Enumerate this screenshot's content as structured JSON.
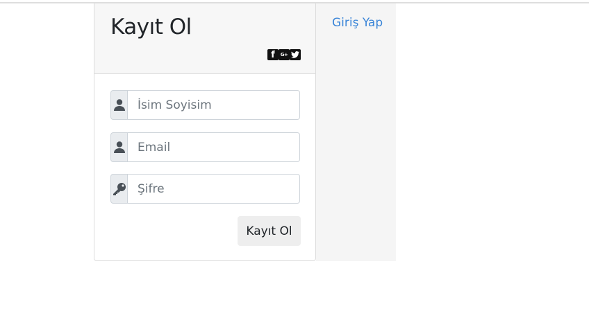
{
  "register_card": {
    "title": "Kayıt Ol",
    "social_icons": [
      "facebook-icon",
      "google-plus-icon",
      "twitter-icon"
    ],
    "name_field": {
      "placeholder": "İsim Soyisim",
      "icon": "user-icon"
    },
    "email_field": {
      "placeholder": "Email",
      "icon": "user-icon"
    },
    "password_field": {
      "placeholder": "Şifre",
      "icon": "key-icon"
    },
    "submit_label": "Kayıt Ol"
  },
  "side_panel": {
    "login_link": "Giriş Yap"
  },
  "colors": {
    "link": "#3a85d8",
    "header_bg": "#f7f7f7",
    "addon_bg": "#e9ecef",
    "button_bg": "#eeeeee"
  }
}
